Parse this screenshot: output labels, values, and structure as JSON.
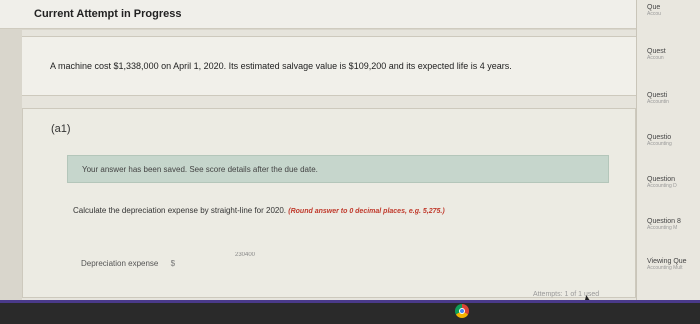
{
  "header": {
    "title": "Current Attempt in Progress"
  },
  "question": {
    "text": "A machine cost $1,338,000 on April 1, 2020. Its estimated salvage value is $109,200 and its expected life is 4 years."
  },
  "part": {
    "label": "(a1)",
    "saved_message": "Your answer has been saved. See score details after the due date.",
    "instruction": "Calculate the depreciation expense by straight-line for 2020.",
    "instruction_hint": "(Round answer to 0 decimal places, e.g. 5,275.)",
    "field_label": "Depreciation expense",
    "currency": "$",
    "answer_value": "230400",
    "attempts": "Attempts: 1 of 1 used"
  },
  "right_panel": {
    "items": [
      {
        "title": "Que",
        "subtitle": "Accou"
      },
      {
        "title": "Quest",
        "subtitle": "Accoun"
      },
      {
        "title": "Questi",
        "subtitle": "Accountin"
      },
      {
        "title": "Questio",
        "subtitle": "Accounting"
      },
      {
        "title": "Question",
        "subtitle": "Accounting D"
      },
      {
        "title": "Question 8",
        "subtitle": "Accounting M"
      },
      {
        "title": "Viewing Que",
        "subtitle": "Accounting Mult"
      }
    ]
  },
  "taskbar": {
    "icons": [
      "chrome-icon"
    ]
  }
}
